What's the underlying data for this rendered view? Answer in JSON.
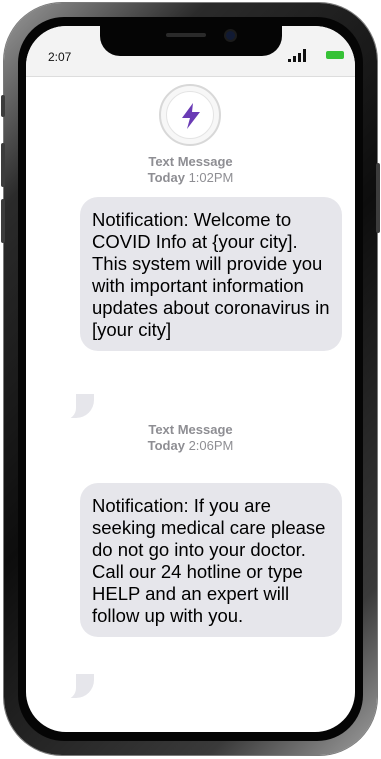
{
  "status_bar": {
    "time": "2:07"
  },
  "contact": {
    "avatar_icon": "lightning-bolt-icon",
    "accent_color": "#6a3bb5"
  },
  "messages": [
    {
      "label": "Text Message",
      "day": "Today",
      "time": "1:02PM",
      "text": "Notification: Welcome to COVID Info at {your city]. This system will provide you with important information updates about coronavirus in [your city]"
    },
    {
      "label": "Text Message",
      "day": "Today",
      "time": "2:06PM",
      "text": "Notification: If you are seeking medical care please do not go into your doctor.  Call our 24 hotline or type HELP and an expert will follow up with you."
    }
  ]
}
